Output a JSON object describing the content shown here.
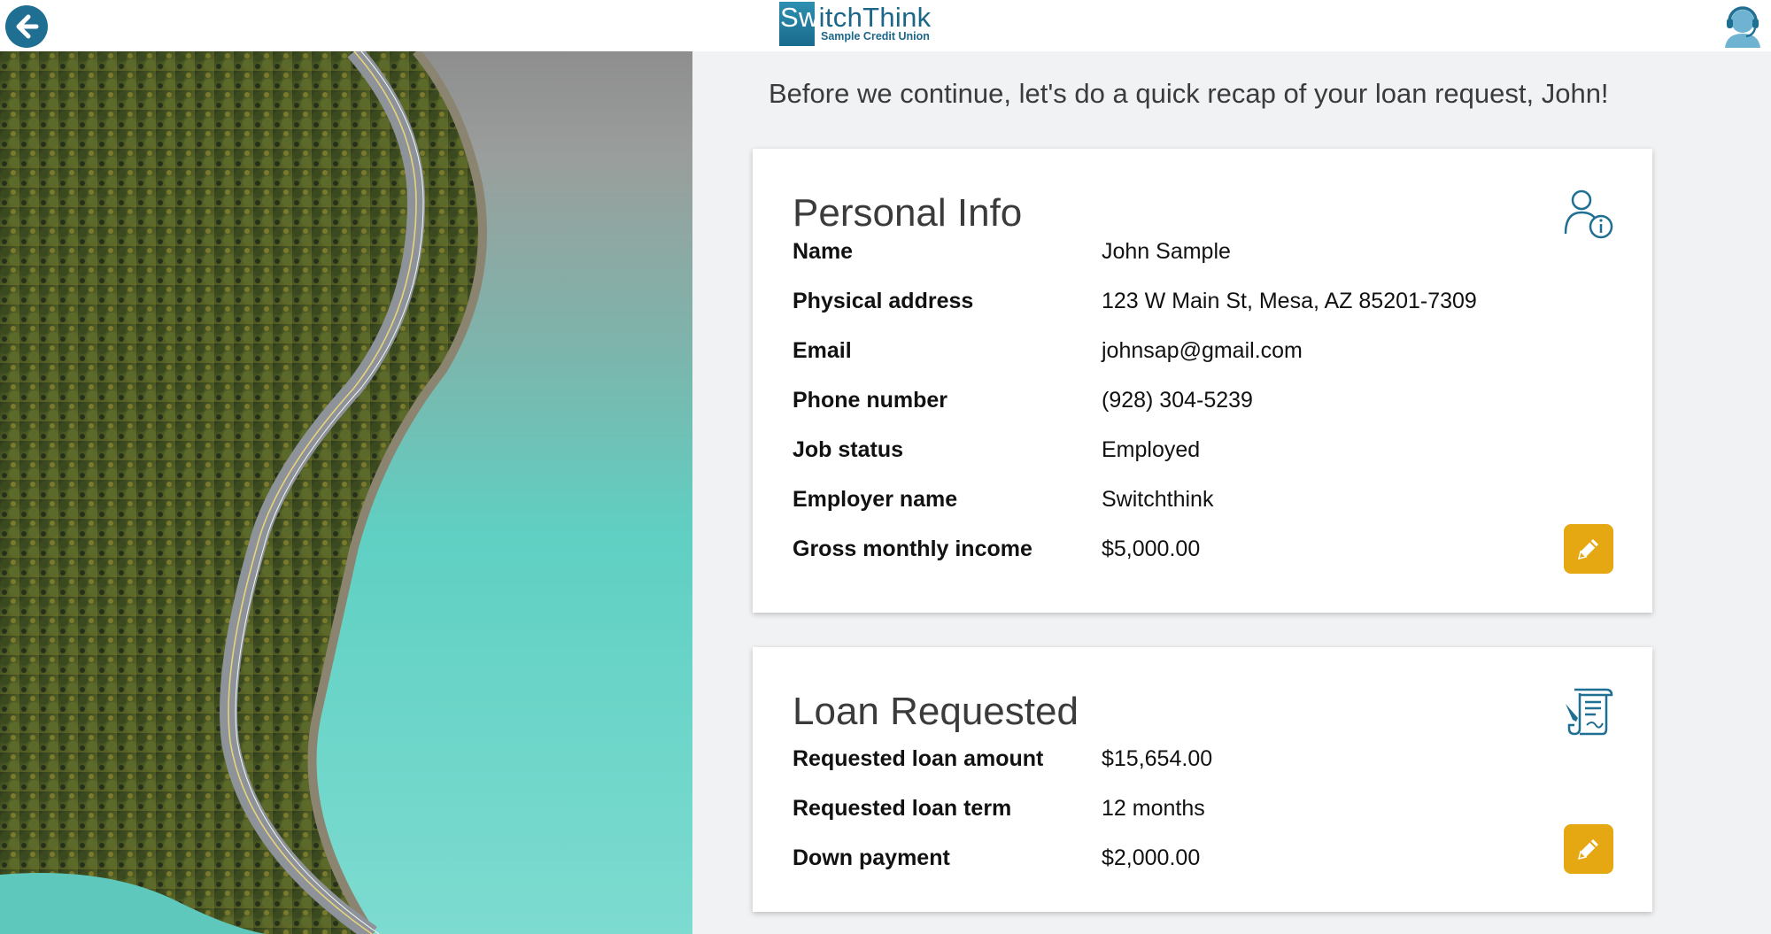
{
  "header": {
    "logo_brand": "SwitchThink",
    "logo_subtitle": "Sample Credit Union",
    "back_icon": "arrow-left-icon",
    "support_icon": "headset-agent-icon"
  },
  "hero_image": {
    "description_icon": "forest-road-lake-photo"
  },
  "intro_text": "Before we continue, let's do a quick recap of your loan request, John!",
  "personal_info": {
    "title": "Personal Info",
    "icon": "user-info-icon",
    "rows": [
      {
        "label": "Name",
        "value": "John Sample"
      },
      {
        "label": "Physical address",
        "value": "123 W Main St, Mesa, AZ 85201-7309"
      },
      {
        "label": "Email",
        "value": "johnsap@gmail.com"
      },
      {
        "label": "Phone number",
        "value": "(928) 304-5239"
      },
      {
        "label": "Job status",
        "value": "Employed"
      },
      {
        "label": "Employer name",
        "value": "Switchthink"
      },
      {
        "label": "Gross monthly income",
        "value": "$5,000.00"
      }
    ],
    "edit_icon": "pencil-icon"
  },
  "loan_requested": {
    "title": "Loan Requested",
    "icon": "document-sign-icon",
    "rows": [
      {
        "label": "Requested loan amount",
        "value": "$15,654.00"
      },
      {
        "label": "Requested loan term",
        "value": "12 months"
      },
      {
        "label": "Down payment",
        "value": "$2,000.00"
      }
    ],
    "edit_icon": "pencil-icon"
  },
  "colors": {
    "accent_blue": "#1f6f93",
    "edit_button": "#e5a812",
    "background": "#f1f2f4"
  }
}
